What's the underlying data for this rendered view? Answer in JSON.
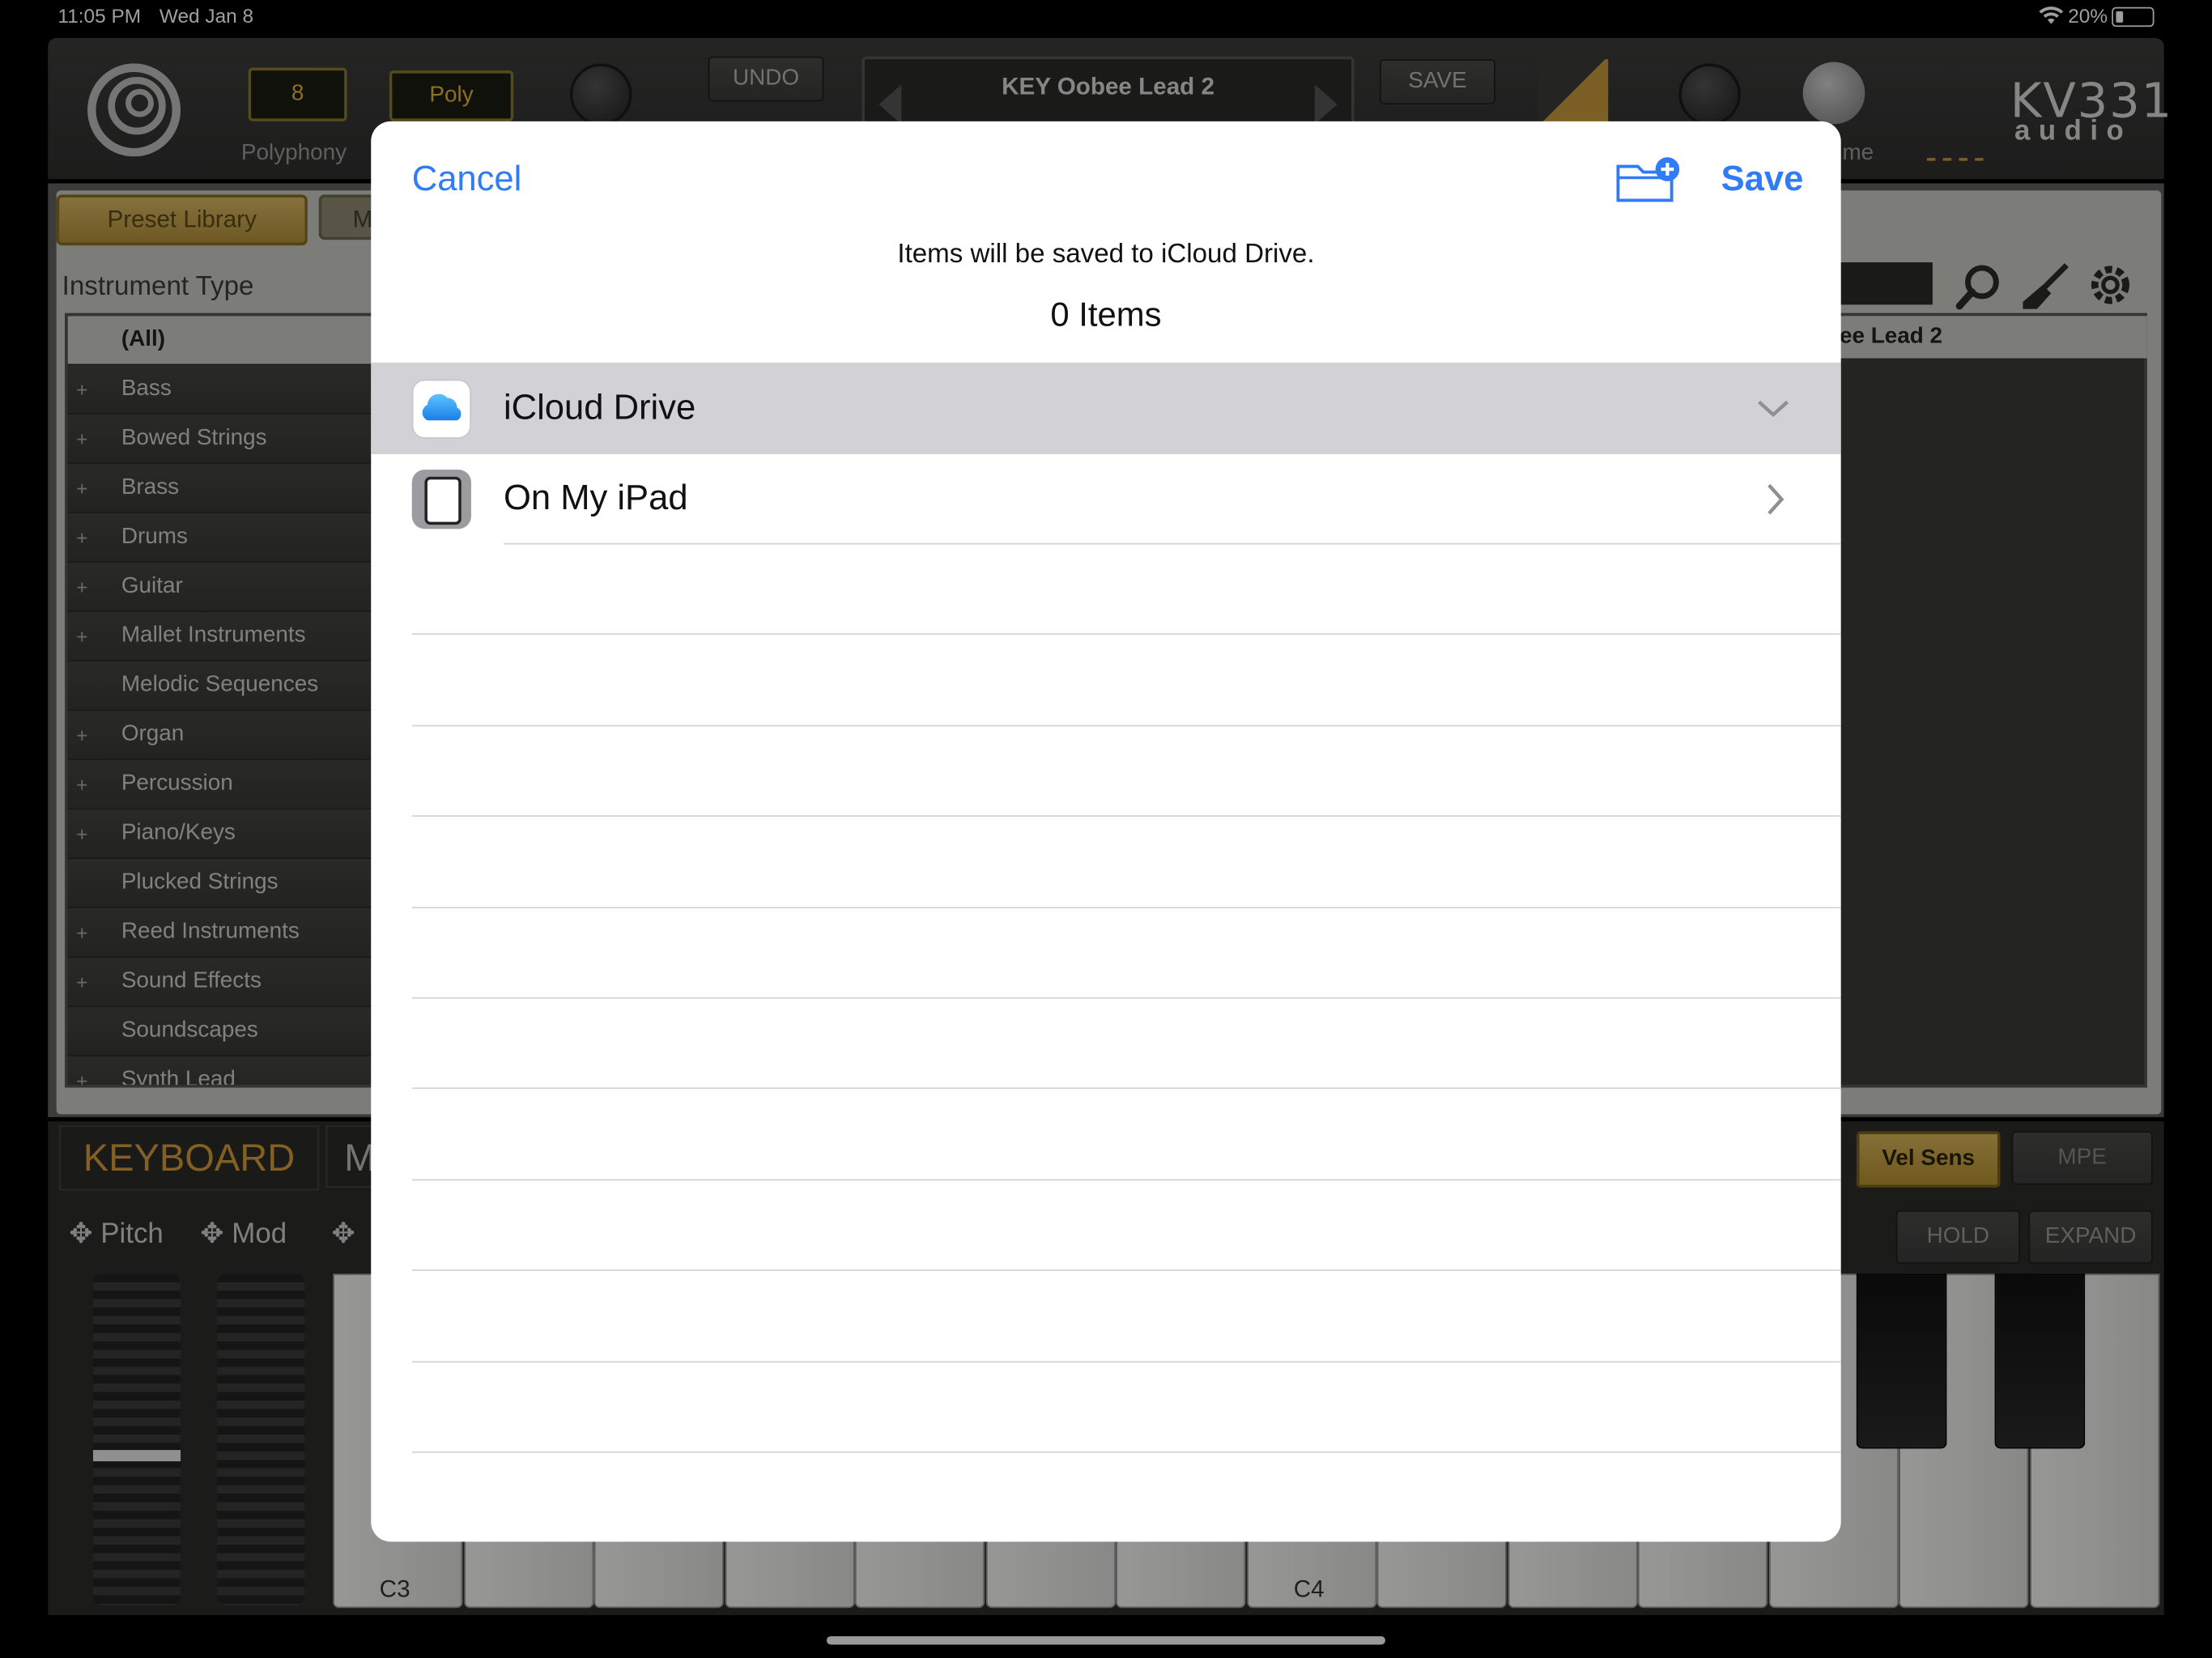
{
  "status_bar": {
    "time": "11:05 PM",
    "date": "Wed Jan 8",
    "battery": "20%"
  },
  "synth": {
    "polyphony_value": "8",
    "poly_mode": "Poly",
    "polyphony_label": "Polyphony",
    "undo_label": "UNDO",
    "preset_name": "KEY Oobee Lead 2",
    "save_label": "SAVE",
    "volume_label_partial": "me",
    "logo_top": "KV331",
    "logo_bottom": "audio",
    "preset_library_tab": "Preset Library",
    "second_tab_partial": "M",
    "instrument_type_label": "Instrument Type",
    "right_list_partial": "ee Lead 2",
    "instrument_types": [
      {
        "label": "(All)",
        "plus": ""
      },
      {
        "label": "Bass",
        "plus": "+"
      },
      {
        "label": "Bowed Strings",
        "plus": "+"
      },
      {
        "label": "Brass",
        "plus": "+"
      },
      {
        "label": "Drums",
        "plus": "+"
      },
      {
        "label": "Guitar",
        "plus": "+"
      },
      {
        "label": "Mallet Instruments",
        "plus": "+"
      },
      {
        "label": "Melodic Sequences",
        "plus": ""
      },
      {
        "label": "Organ",
        "plus": "+"
      },
      {
        "label": "Percussion",
        "plus": "+"
      },
      {
        "label": "Piano/Keys",
        "plus": "+"
      },
      {
        "label": "Plucked Strings",
        "plus": ""
      },
      {
        "label": "Reed Instruments",
        "plus": "+"
      },
      {
        "label": "Sound Effects",
        "plus": "+"
      },
      {
        "label": "Soundscapes",
        "plus": ""
      },
      {
        "label": "Synth Lead",
        "plus": "+"
      }
    ],
    "keyboard_tab": "KEYBOARD",
    "keyboard_tab2_partial": "M",
    "pitch_label": "Pitch",
    "mod_label": "Mod",
    "vel_sens_label": "Vel Sens",
    "mpe_label": "MPE",
    "hold_label": "HOLD",
    "expand_label": "EXPAND",
    "key_c3": "C3",
    "key_c4": "C4"
  },
  "modal": {
    "cancel_label": "Cancel",
    "save_label": "Save",
    "info_text": "Items will be saved to iCloud Drive.",
    "items_count": "0 Items",
    "locations": [
      {
        "label": "iCloud Drive",
        "icon": "icloud-icon",
        "selected": true,
        "accessory": "chevron-down-icon"
      },
      {
        "label": "On My iPad",
        "icon": "ipad-icon",
        "selected": false,
        "accessory": "chevron-right-icon"
      }
    ]
  }
}
